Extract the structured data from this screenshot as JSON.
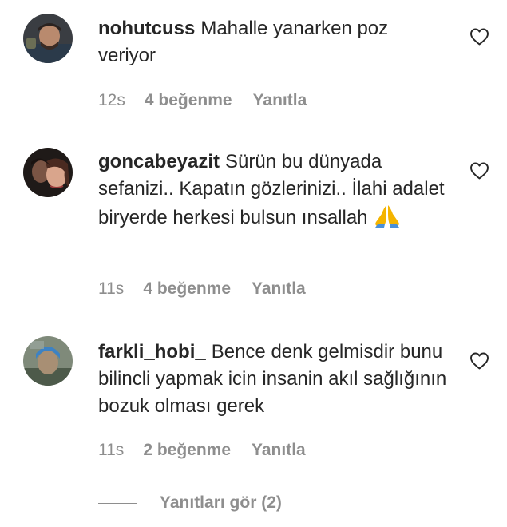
{
  "comments": [
    {
      "username": "nohutcuss",
      "text": "Mahalle yanarken poz veriyor",
      "time": "12s",
      "likes": "4 beğenme",
      "reply": "Yanıtla",
      "avatar_icon": "user-avatar-photo",
      "like_icon": "heart-outline-icon"
    },
    {
      "username": "goncabeyazit",
      "text": "Sürün bu dünyada sefanizi.. Kapatın gözlerinizi.. İlahi adalet biryerde herkesi bulsun ınsallah",
      "emoji": "folded-hands-emoji",
      "time": "11s",
      "likes": "4 beğenme",
      "reply": "Yanıtla",
      "avatar_icon": "user-avatar-photo",
      "like_icon": "heart-outline-icon"
    },
    {
      "username": "farkli_hobi_",
      "text": "Bence denk gelmisdir bunu bilincli yapmak icin insanin akıl sağlığının bozuk olması gerek",
      "time": "11s",
      "likes": "2 beğenme",
      "reply": "Yanıtla",
      "avatar_icon": "user-avatar-photo",
      "like_icon": "heart-outline-icon"
    }
  ],
  "view_replies": "Yanıtları gör (2)",
  "colors": {
    "text": "#262626",
    "secondary": "#8e8e8e",
    "background": "#ffffff"
  }
}
